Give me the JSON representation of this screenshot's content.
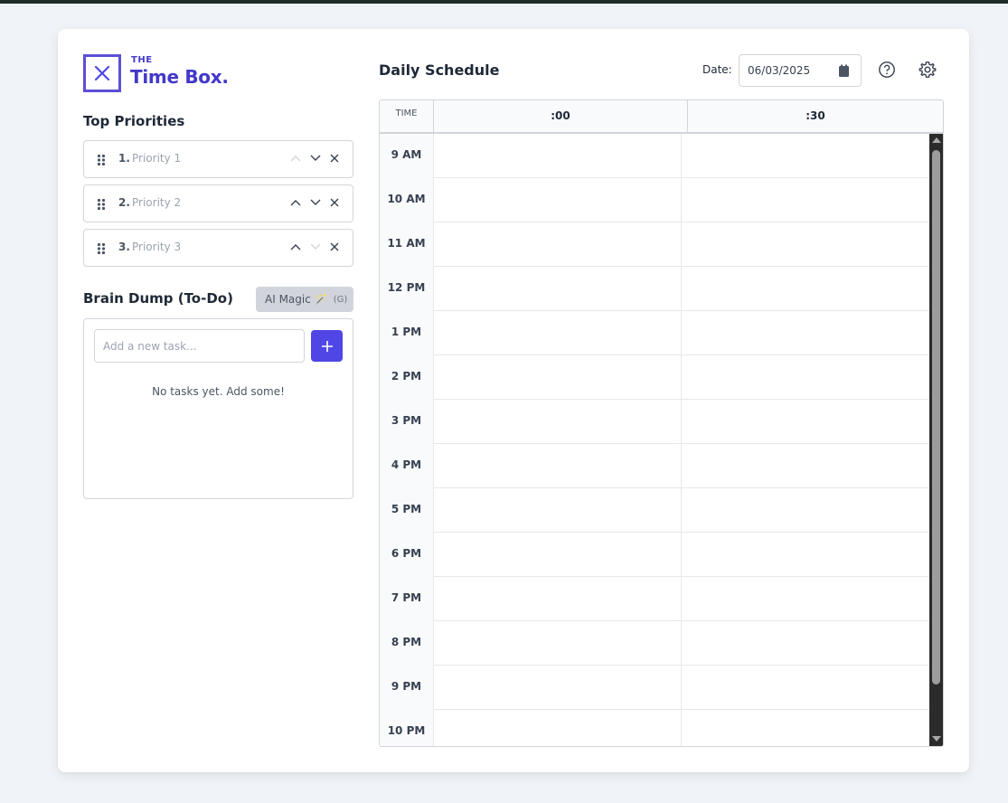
{
  "brand": {
    "the": "THE",
    "title": "Time Box.",
    "logo_icon": "close-icon",
    "color": "#4338ca"
  },
  "priorities": {
    "title": "Top Priorities",
    "items": [
      {
        "num": "1.",
        "placeholder": "Priority 1"
      },
      {
        "num": "2.",
        "placeholder": "Priority 2"
      },
      {
        "num": "3.",
        "placeholder": "Priority 3"
      }
    ]
  },
  "brain_dump": {
    "title": "Brain Dump (To-Do)",
    "ai_label": "AI Magic",
    "ai_emoji": "🪄",
    "ai_hint": "(G)",
    "input_placeholder": "Add a new task...",
    "add_icon": "plus-icon",
    "empty_text": "No tasks yet. Add some!"
  },
  "schedule": {
    "title": "Daily Schedule",
    "date_label": "Date:",
    "date_value": "06/03/2025",
    "col_time": "TIME",
    "col_1": ":00",
    "col_2": ":30",
    "hours": [
      "9 AM",
      "10 AM",
      "11 AM",
      "12 PM",
      "1 PM",
      "2 PM",
      "3 PM",
      "4 PM",
      "5 PM",
      "6 PM",
      "7 PM",
      "8 PM",
      "9 PM",
      "10 PM"
    ]
  },
  "colors": {
    "accent": "#4f46e5",
    "border": "#d1d5db"
  }
}
